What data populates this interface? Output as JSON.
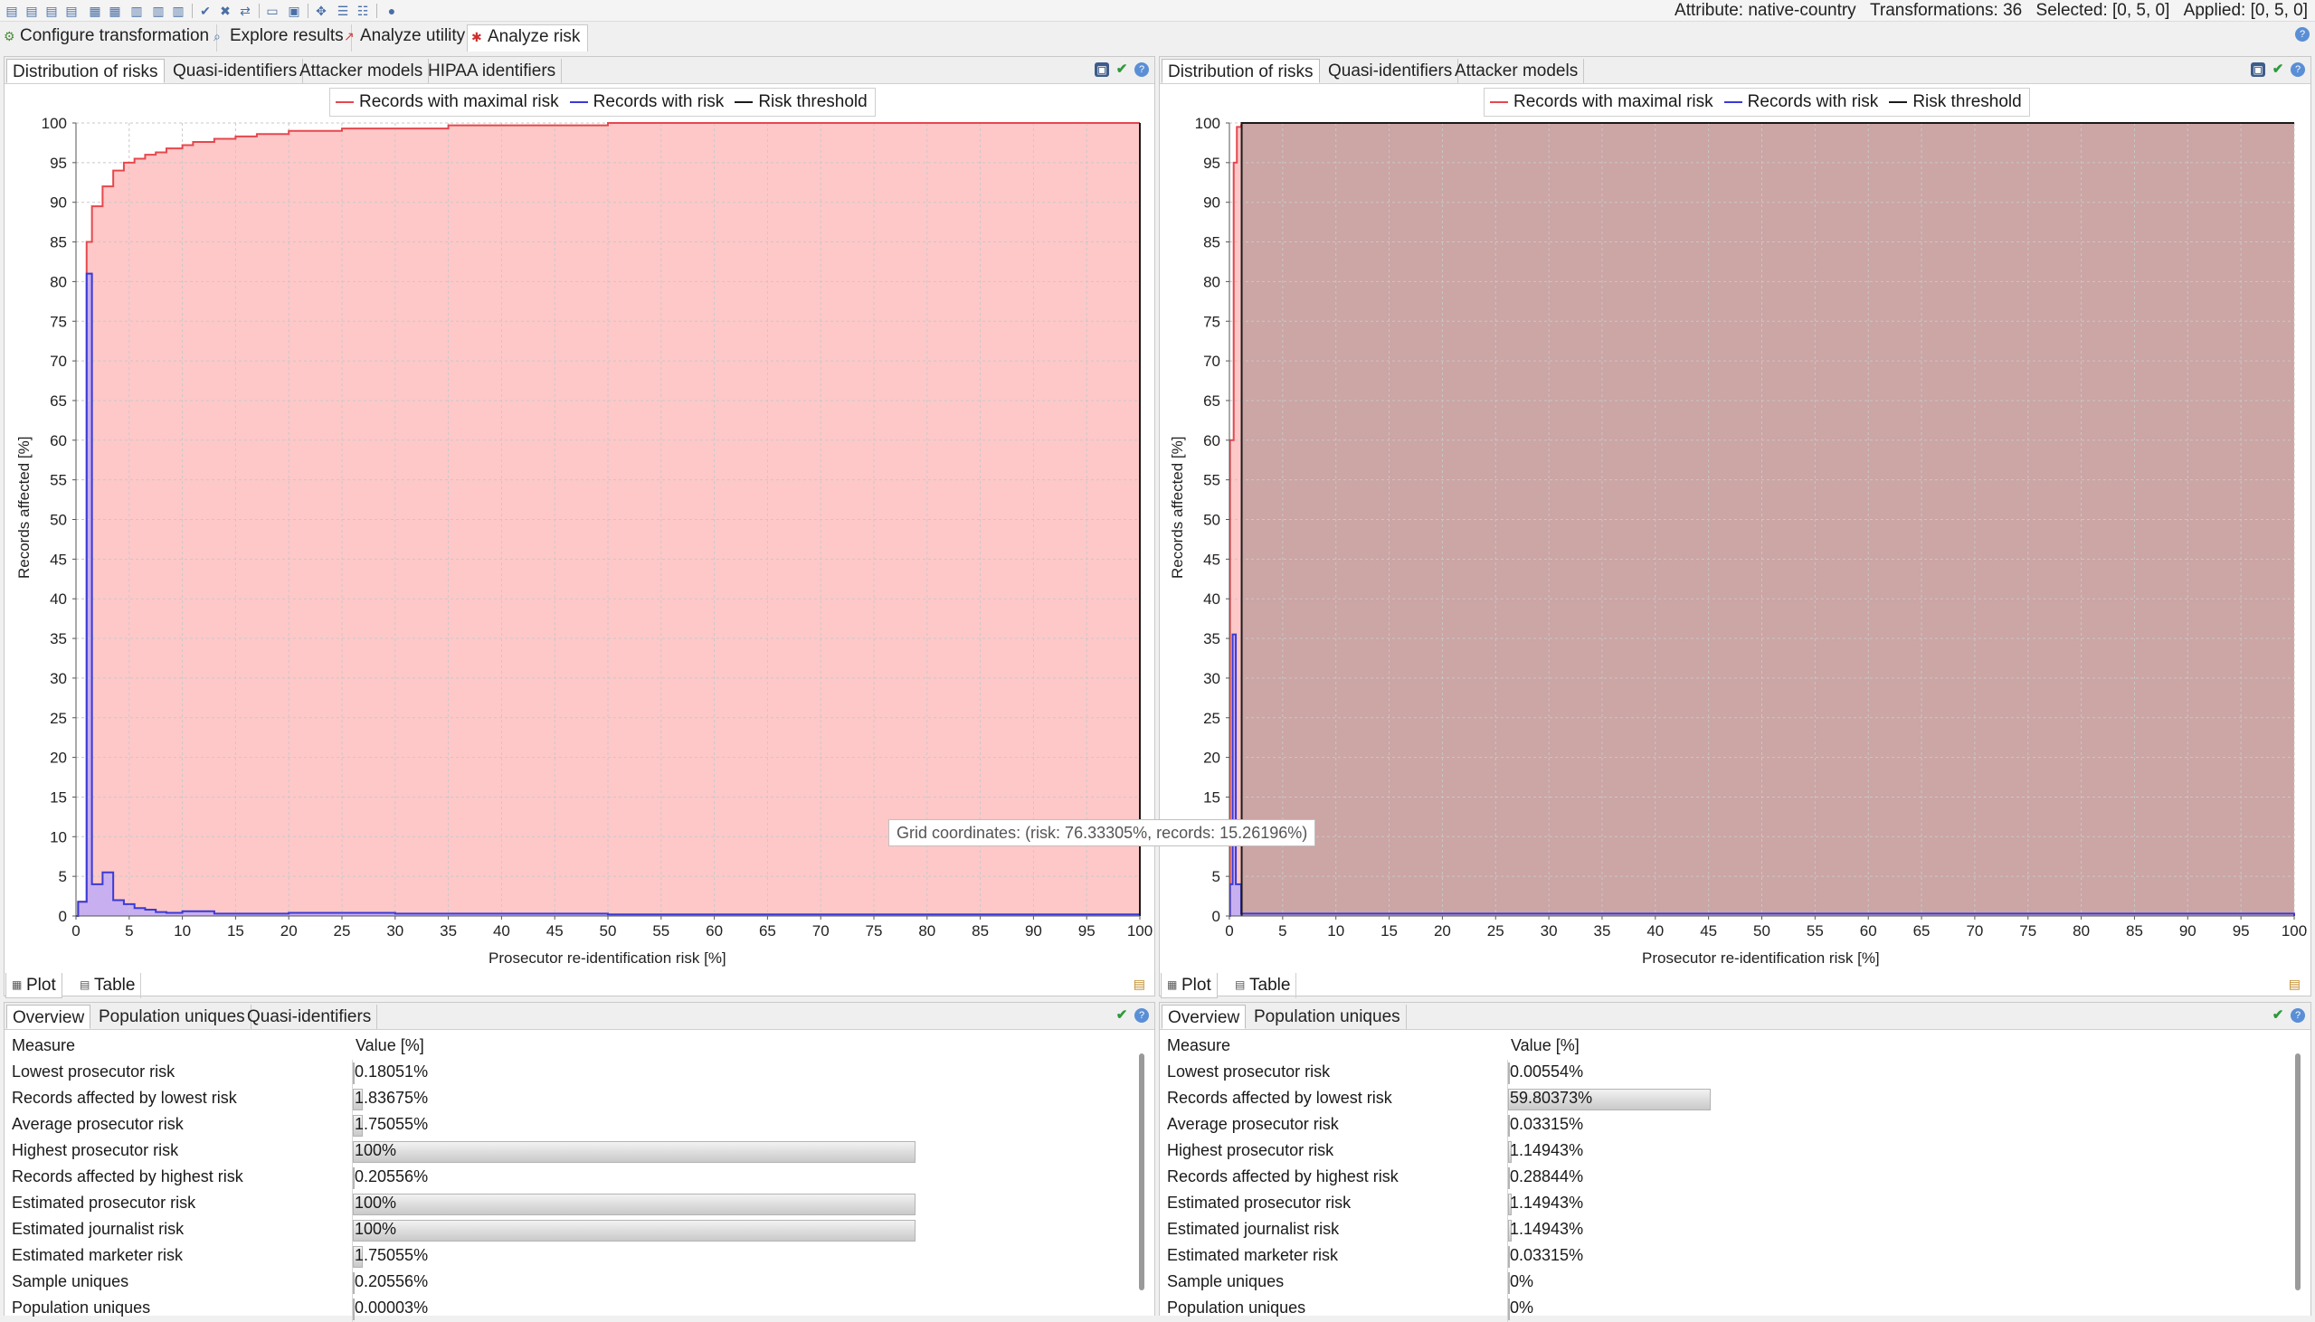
{
  "toolbar": {
    "status": {
      "attribute": "Attribute: native-country",
      "transformations": "Transformations: 36",
      "selected": "Selected: [0, 5, 0]",
      "applied": "Applied: [0, 5, 0]"
    }
  },
  "perspectives": [
    {
      "label": "Configure transformation",
      "icon": "configure-icon"
    },
    {
      "label": "Explore results",
      "icon": "explore-icon"
    },
    {
      "label": "Analyze utility",
      "icon": "utility-icon"
    },
    {
      "label": "Analyze risk",
      "icon": "risk-icon"
    }
  ],
  "left": {
    "tabs": [
      "Distribution of risks",
      "Quasi-identifiers",
      "Attacker models",
      "HIPAA identifiers"
    ],
    "bottom_tabs": [
      "Plot",
      "Table"
    ],
    "table_tabs": [
      "Overview",
      "Population uniques",
      "Quasi-identifiers"
    ],
    "table_headers": [
      "Measure",
      "Value [%]"
    ],
    "rows": [
      {
        "measure": "Lowest prosecutor risk",
        "value": "0.18051%",
        "level": 0.18051
      },
      {
        "measure": "Records affected by lowest risk",
        "value": "1.83675%",
        "level": 1.83675
      },
      {
        "measure": "Average prosecutor risk",
        "value": "1.75055%",
        "level": 1.75055
      },
      {
        "measure": "Highest prosecutor risk",
        "value": "100%",
        "level": 100
      },
      {
        "measure": "Records affected by highest risk",
        "value": "0.20556%",
        "level": 0.20556
      },
      {
        "measure": "Estimated prosecutor risk",
        "value": "100%",
        "level": 100
      },
      {
        "measure": "Estimated journalist risk",
        "value": "100%",
        "level": 100
      },
      {
        "measure": "Estimated marketer risk",
        "value": "1.75055%",
        "level": 1.75055
      },
      {
        "measure": "Sample uniques",
        "value": "0.20556%",
        "level": 0.20556
      },
      {
        "measure": "Population uniques",
        "value": "0.00003%",
        "level": 3e-05
      }
    ]
  },
  "right": {
    "tabs": [
      "Distribution of risks",
      "Quasi-identifiers",
      "Attacker models"
    ],
    "bottom_tabs": [
      "Plot",
      "Table"
    ],
    "table_tabs": [
      "Overview",
      "Population uniques"
    ],
    "table_headers": [
      "Measure",
      "Value [%]"
    ],
    "rows": [
      {
        "measure": "Lowest prosecutor risk",
        "value": "0.00554%",
        "level": 0.00554
      },
      {
        "measure": "Records affected by lowest risk",
        "value": "59.80373%",
        "level": 59.80373
      },
      {
        "measure": "Average prosecutor risk",
        "value": "0.03315%",
        "level": 0.03315
      },
      {
        "measure": "Highest prosecutor risk",
        "value": "1.14943%",
        "level": 1.14943
      },
      {
        "measure": "Records affected by highest risk",
        "value": "0.28844%",
        "level": 0.28844
      },
      {
        "measure": "Estimated prosecutor risk",
        "value": "1.14943%",
        "level": 1.14943
      },
      {
        "measure": "Estimated journalist risk",
        "value": "1.14943%",
        "level": 1.14943
      },
      {
        "measure": "Estimated marketer risk",
        "value": "0.03315%",
        "level": 0.03315
      },
      {
        "measure": "Sample uniques",
        "value": "0%",
        "level": 0
      },
      {
        "measure": "Population uniques",
        "value": "0%",
        "level": 0
      }
    ]
  },
  "tooltip": "Grid coordinates: (risk: 76.33305%, records: 15.26196%)",
  "chart_data": [
    {
      "type": "area",
      "xlabel": "Prosecutor re-identification risk [%]",
      "ylabel": "Records affected [%]",
      "xlim": [
        0,
        100
      ],
      "ylim": [
        0,
        100
      ],
      "xticks": [
        0,
        5,
        10,
        15,
        20,
        25,
        30,
        35,
        40,
        45,
        50,
        55,
        60,
        65,
        70,
        75,
        80,
        85,
        90,
        95,
        100
      ],
      "yticks": [
        0,
        5,
        10,
        15,
        20,
        25,
        30,
        35,
        40,
        45,
        50,
        55,
        60,
        65,
        70,
        75,
        80,
        85,
        90,
        95,
        100
      ],
      "grid": true,
      "legend_position": "top-center",
      "series": [
        {
          "name": "Records with maximal risk",
          "color": "#e5484d",
          "fill": "#ffc8c8",
          "x": [
            0,
            0.2,
            1,
            1.5,
            2.5,
            3.5,
            4.5,
            5.5,
            6.5,
            7.5,
            8.5,
            10,
            11,
            13,
            15,
            17,
            20,
            25,
            35,
            50,
            100
          ],
          "y": [
            0,
            1.8,
            85,
            89.5,
            92,
            94,
            95,
            95.5,
            96,
            96.3,
            96.8,
            97.2,
            97.6,
            98,
            98.3,
            98.6,
            99,
            99.3,
            99.7,
            100,
            100
          ]
        },
        {
          "name": "Records with risk",
          "color": "#3a3ad6",
          "fill": "#c8aff0",
          "x": [
            0,
            0.2,
            1,
            1.5,
            2.5,
            3.5,
            4.5,
            5.5,
            6.5,
            7.5,
            8.5,
            10,
            13,
            20,
            30,
            50,
            100
          ],
          "y": [
            0,
            1.8,
            81,
            4,
            5.5,
            2,
            1.5,
            1,
            0.8,
            0.5,
            0.4,
            0.6,
            0.3,
            0.4,
            0.3,
            0.2,
            0.1
          ]
        },
        {
          "name": "Risk threshold",
          "color": "#1a1a1a",
          "x": [
            100,
            100
          ],
          "y": [
            0,
            100
          ]
        }
      ]
    },
    {
      "type": "area",
      "xlabel": "Prosecutor re-identification risk [%]",
      "ylabel": "Records affected [%]",
      "xlim": [
        0,
        100
      ],
      "ylim": [
        0,
        100
      ],
      "xticks": [
        0,
        5,
        10,
        15,
        20,
        25,
        30,
        35,
        40,
        45,
        50,
        55,
        60,
        65,
        70,
        75,
        80,
        85,
        90,
        95,
        100
      ],
      "yticks": [
        0,
        5,
        10,
        15,
        20,
        25,
        30,
        35,
        40,
        45,
        50,
        55,
        60,
        65,
        70,
        75,
        80,
        85,
        90,
        95,
        100
      ],
      "grid": true,
      "legend_position": "top-center",
      "series": [
        {
          "name": "Records with maximal risk",
          "color": "#e5484d",
          "fill": "#ffc8c8",
          "x": [
            0,
            0.05,
            0.4,
            0.7,
            1.1,
            1.15,
            100
          ],
          "y": [
            0,
            60,
            95,
            99.5,
            99.7,
            100,
            100
          ]
        },
        {
          "name": "Records with risk",
          "color": "#3a3ad6",
          "fill": "#c8aff0",
          "x": [
            0,
            0.05,
            0.3,
            0.6,
            1.1,
            1.15,
            100
          ],
          "y": [
            0,
            4,
            35.5,
            4,
            0.3,
            0.3,
            0
          ]
        },
        {
          "name": "Risk threshold",
          "color": "#1a1a1a",
          "fill": "#c9a3a3",
          "x": [
            1.15,
            1.15,
            100
          ],
          "y": [
            0,
            100,
            100
          ]
        }
      ]
    }
  ]
}
